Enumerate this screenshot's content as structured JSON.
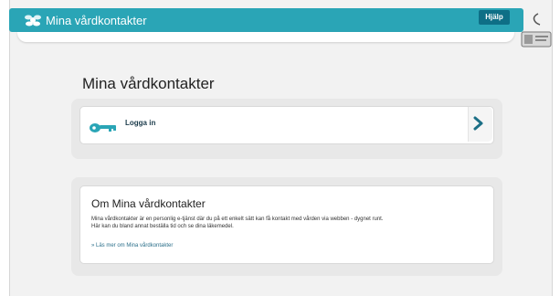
{
  "header": {
    "app_title": "Mina vårdkontakter",
    "help_label": "Hjälp",
    "logo_icon": "flower-logo-icon",
    "id_card_icon": "id-card-icon",
    "accent_color": "#2aa5b6"
  },
  "main": {
    "page_title": "Mina vårdkontakter",
    "login": {
      "label": "Logga in",
      "icon": "key-icon",
      "arrow_icon": "chevron-right-icon"
    },
    "about": {
      "heading": "Om Mina vårdkontakter",
      "text_line1": "Mina vårdkontakter är en personlig e-tjänst där du på ett enkelt sätt kan få kontakt med vården via webben - dygnet runt.",
      "text_line2": "Här kan du bland annat beställa tid och se dina läkemedel.",
      "link": "» Läs mer om Mina vårdkontakter"
    }
  }
}
